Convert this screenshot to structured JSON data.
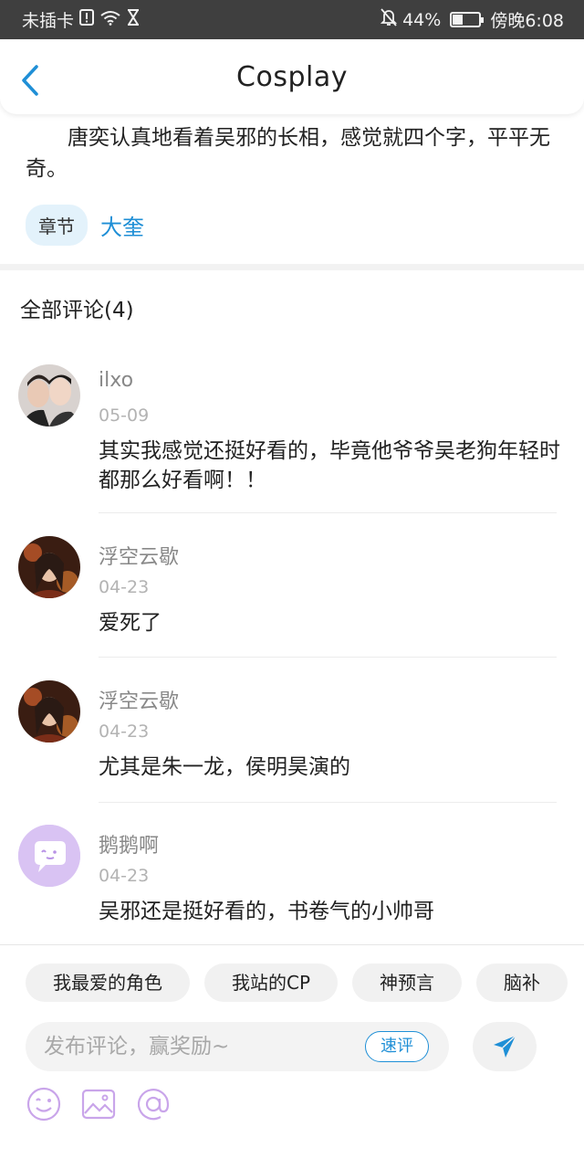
{
  "status_bar": {
    "carrier": "未插卡",
    "battery_percent": "44%",
    "battery_level": 0.44,
    "time": "傍晚6:08"
  },
  "header": {
    "title": "Cosplay",
    "back_icon": "chevron-left-icon"
  },
  "excerpt": "唐奕认真地看着吴邪的长相，感觉就四个字，平平无奇。",
  "chapter": {
    "tag": "章节",
    "name": "大奎"
  },
  "comments_title": "全部评论(4)",
  "comments": [
    {
      "user": "ilxo",
      "date": "05-09",
      "text": "其实我感觉还挺好看的，毕竟他爷爷吴老狗年轻时都那么好看啊！！"
    },
    {
      "user": "浮空云歇",
      "date": "04-23",
      "text": "爱死了"
    },
    {
      "user": "浮空云歇",
      "date": "04-23",
      "text": "尤其是朱一龙，侯明昊演的"
    },
    {
      "user": "鹅鹅啊",
      "date": "04-23",
      "text": "吴邪还是挺好看的，书卷气的小帅哥"
    }
  ],
  "quick_chips": [
    "我最爱的角色",
    "我站的CP",
    "神预言",
    "脑补"
  ],
  "input": {
    "placeholder": "发布评论，赢奖励~",
    "value": "",
    "quick_label": "速评"
  },
  "colors": {
    "accent": "#1f8fd6",
    "tool_icon": "#c9a5ea",
    "status_bar": "#3f3f3f"
  },
  "icons": {
    "send": "send-icon",
    "emoji": "emoji-icon",
    "image": "image-icon",
    "mention": "at-icon"
  }
}
